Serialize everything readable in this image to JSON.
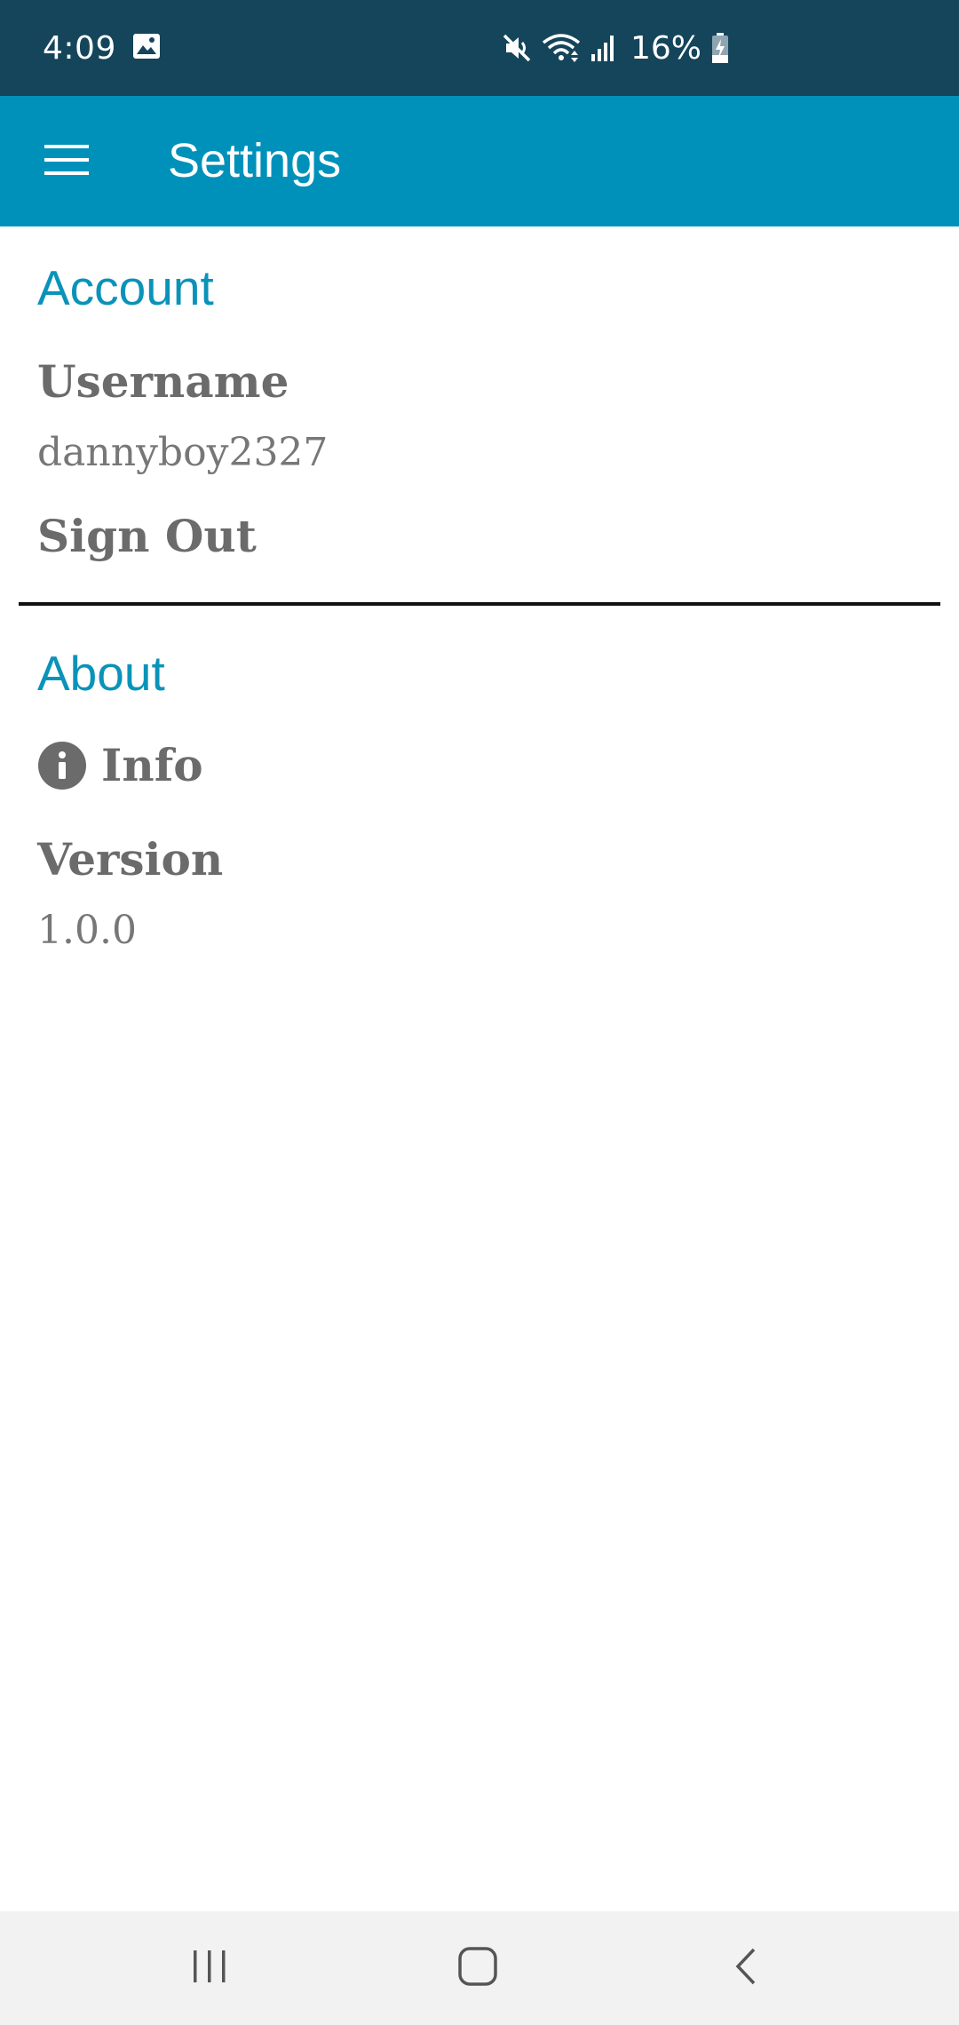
{
  "status_bar": {
    "time": "4:09",
    "battery": "16%",
    "icons": [
      "image-icon",
      "mute-icon",
      "wifi-icon",
      "signal-icon",
      "battery-charging-icon"
    ]
  },
  "app_bar": {
    "title": "Settings",
    "menu_icon": "hamburger-menu-icon",
    "background": "#0091bb"
  },
  "account": {
    "header": "Account",
    "username_label": "Username",
    "username_value": "dannyboy2327",
    "sign_out_label": "Sign Out"
  },
  "about": {
    "header": "About",
    "info_label": "Info",
    "info_icon": "info-icon",
    "version_label": "Version",
    "version_value": "1.0.0"
  },
  "nav_bar": {
    "icons": [
      "recent-apps-icon",
      "home-icon",
      "back-icon"
    ]
  },
  "colors": {
    "status_bar": "#14455b",
    "accent": "#0a93b9",
    "text_gray": "#6b6b6b"
  }
}
